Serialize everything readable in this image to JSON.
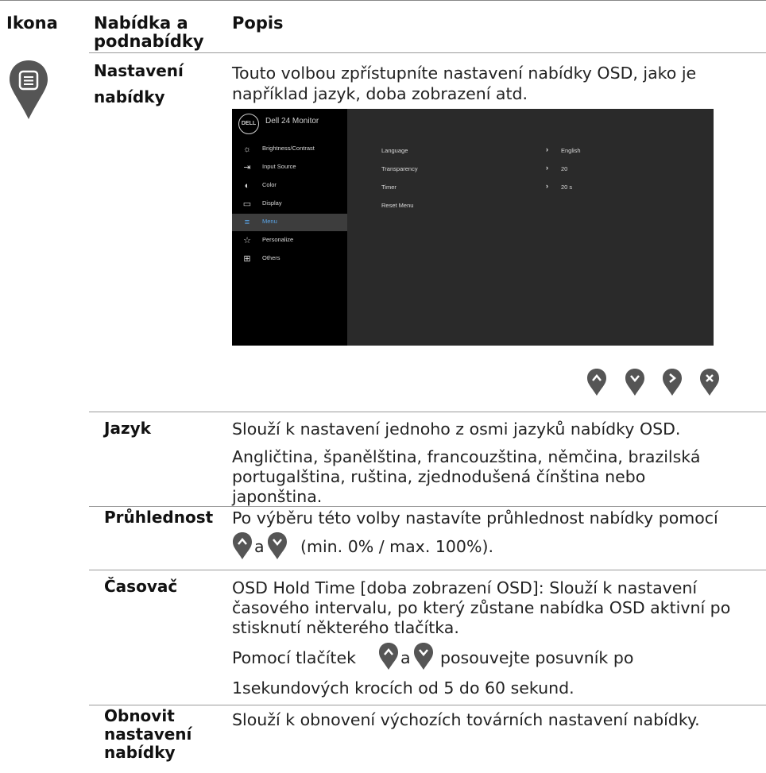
{
  "header": {
    "col1": "Ikona",
    "col2_line1": "Nabídka a",
    "col2_line2": "podnabídky",
    "col3": "Popis"
  },
  "main_row": {
    "label_line1": "Nastavení",
    "label_line2": "nabídky",
    "desc_line1": "Touto volbou zpřístupníte nastavení nabídky OSD, jako je",
    "desc_line2": "například jazyk, doba zobrazení atd.",
    "icon": "menu-icon"
  },
  "osd": {
    "title": "Dell 24 Monitor",
    "logo": "DELL",
    "menu_items": [
      {
        "label": "Brightness/Contrast",
        "icon": "sun-icon"
      },
      {
        "label": "Input Source",
        "icon": "input-icon"
      },
      {
        "label": "Color",
        "icon": "palette-icon"
      },
      {
        "label": "Display",
        "icon": "display-icon"
      },
      {
        "label": "Menu",
        "icon": "menu-icon"
      },
      {
        "label": "Personalize",
        "icon": "star-icon"
      },
      {
        "label": "Others",
        "icon": "others-icon"
      }
    ],
    "selected_item": "Menu",
    "settings": [
      {
        "name": "Language",
        "arrow": "›",
        "value": "English"
      },
      {
        "name": "Transparency",
        "arrow": "›",
        "value": "20"
      },
      {
        "name": "Timer",
        "arrow": "›",
        "value": "20 s"
      },
      {
        "name": "Reset Menu",
        "arrow": "",
        "value": ""
      }
    ]
  },
  "nav_buttons": [
    "up-button",
    "down-button",
    "next-button",
    "exit-button"
  ],
  "rows": {
    "jazyk": {
      "label": "Jazyk",
      "line1": "Slouží k nastavení jednoho z osmi jazyků nabídky OSD.",
      "line2": "Angličtina, španělština, francouzština, němčina, brazilská",
      "line3": "portugalština, ruština, zjednodušená čínština nebo",
      "line4": "japonština."
    },
    "pruhlednost": {
      "label": "Průhlednost",
      "line1": "Po výběru této volby nastavíte průhlednost nabídky pomocí",
      "line2_mid": "a",
      "line2_end": "(min. 0% / max. 100%)."
    },
    "casovac": {
      "label": "Časovač",
      "line1": "OSD Hold Time [doba zobrazení OSD]: Slouží k nastavení",
      "line2": "časového intervalu, po který zůstane nabídka OSD aktivní po",
      "line3": "stisknutí některého tlačítka.",
      "line4_start": "Pomocí tlačítek",
      "line4_mid": "a",
      "line4_end": "posouvejte posuvník po",
      "line5": "1sekundových krocích od 5 do 60 sekund."
    },
    "obnovit": {
      "label_line1": "Obnovit",
      "label_line2": "nastavení",
      "label_line3": "nabídky",
      "line1": "Slouží k obnovení výchozích továrních nastavení nabídky."
    }
  },
  "colors": {
    "button_gray": "#555555",
    "osd_left_bg": "#000000",
    "osd_right_bg": "#2a2a2a",
    "osd_accent": "#5aa4e6"
  }
}
